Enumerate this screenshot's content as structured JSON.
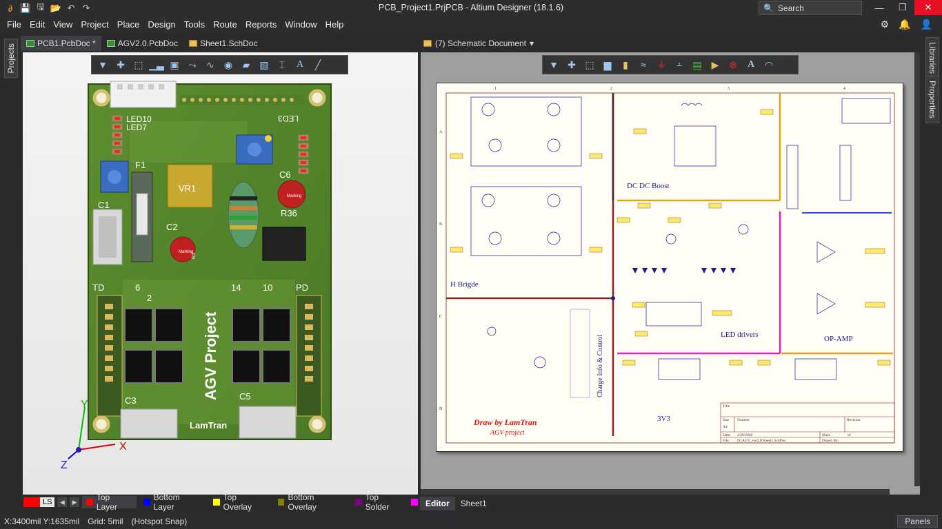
{
  "window": {
    "title": "PCB_Project1.PrjPCB - Altium Designer (18.1.6)",
    "search_placeholder": "Search"
  },
  "menu": [
    "File",
    "Edit",
    "View",
    "Project",
    "Place",
    "Design",
    "Tools",
    "Route",
    "Reports",
    "Window",
    "Help"
  ],
  "left_panel": {
    "tab": "Projects"
  },
  "right_panels": [
    "Libraries",
    "Properties"
  ],
  "doc_tabs": [
    {
      "label": "PCB1.PcbDoc *",
      "type": "pcb",
      "active": true
    },
    {
      "label": "AGV2.0.PcbDoc",
      "type": "pcb",
      "active": false
    },
    {
      "label": "Sheet1.SchDoc",
      "type": "sch",
      "active": false
    }
  ],
  "schematic_tab": {
    "label": "(7) Schematic Document"
  },
  "pcb": {
    "silk": {
      "led10": "LED10",
      "led7": "LED7",
      "led3": "LED3",
      "f1": "F1",
      "vr1": "VR1",
      "c6": "C6",
      "c1": "C1",
      "r3": "R3",
      "c2": "C2",
      "r36": "R36",
      "td": "TD",
      "pd": "PD",
      "n6": "6",
      "n2": "2",
      "n14": "14",
      "n10": "10",
      "c3": "C3",
      "c5": "C5",
      "project": "AGV Project",
      "author": "LamTran",
      "marking": "Marking"
    },
    "axis": {
      "x": "X",
      "y": "Y",
      "z": "Z"
    }
  },
  "schematic": {
    "sections": {
      "hbridge": "H Brigde",
      "dcdc": "DC DC Boost",
      "led": "LED drivers",
      "opamp": "OP-AMP",
      "v3": "3V3",
      "charge": "Charge Info & Control"
    },
    "credit": {
      "line1": "Draw by LamTran",
      "line2": "AGV project"
    },
    "title_block": {
      "title": "Title",
      "size": "Size",
      "number": "Number",
      "revision": "Revision",
      "a4": "A4",
      "date_label": "Date:",
      "date": "2/28/2020",
      "file_label": "File:",
      "file": "D:\\AGV_ver2.0\\Sheet1.SchDoc",
      "sheet": "Sheet",
      "of": "of",
      "drawn_by": "Drawn By:"
    },
    "border_cols": [
      "1",
      "2",
      "3",
      "4"
    ],
    "border_rows": [
      "A",
      "B",
      "C",
      "D"
    ]
  },
  "layers": [
    {
      "label": "Top Layer",
      "color": "#ff0000",
      "active": true
    },
    {
      "label": "Bottom Layer",
      "color": "#0000ff",
      "active": false
    },
    {
      "label": "Top Overlay",
      "color": "#ffff00",
      "active": false
    },
    {
      "label": "Bottom Overlay",
      "color": "#808000",
      "active": false
    },
    {
      "label": "Top Solder",
      "color": "#800080",
      "active": false
    }
  ],
  "ls_label": "LS",
  "bottom_tabs": [
    {
      "label": "Editor",
      "active": true
    },
    {
      "label": "Sheet1",
      "active": false
    }
  ],
  "status": {
    "coords": "X:3400mil Y:1635mil",
    "grid": "Grid: 5mil",
    "snap": "(Hotspot Snap)",
    "panels": "Panels"
  }
}
